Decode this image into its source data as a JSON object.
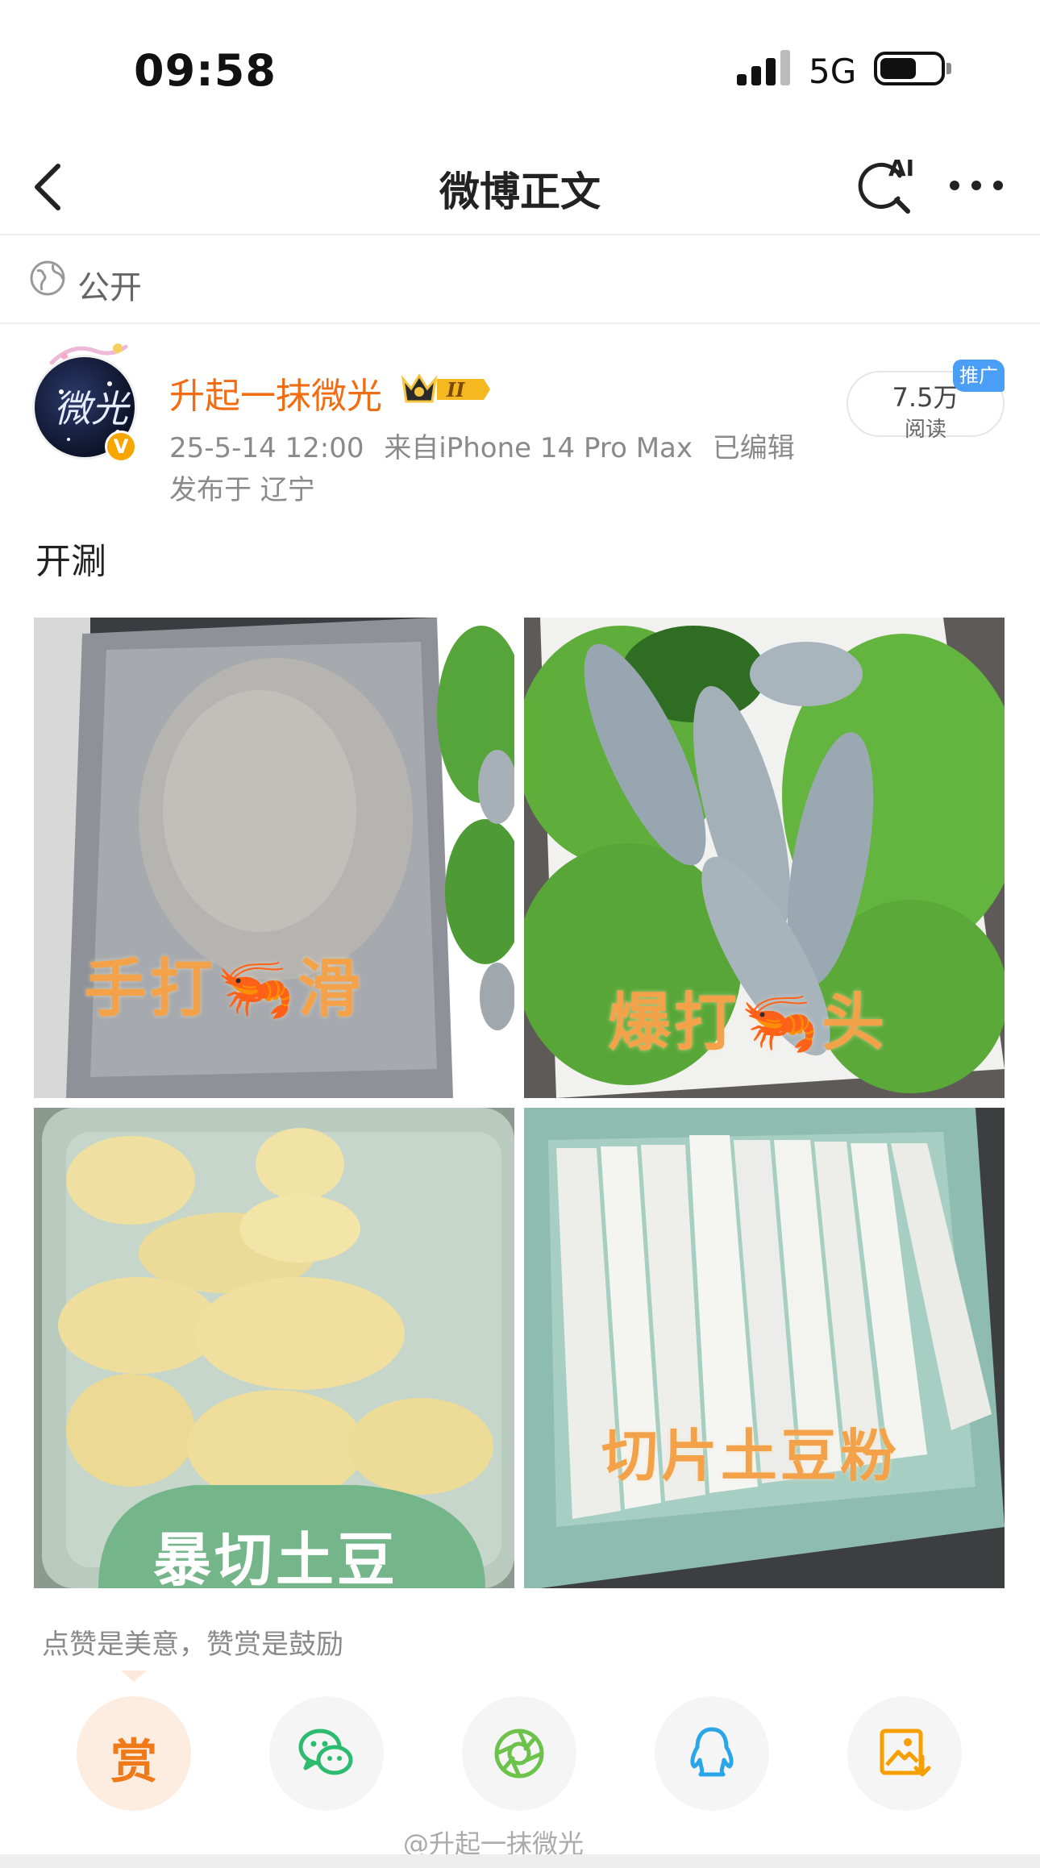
{
  "status_bar": {
    "time": "09:58",
    "network": "5G"
  },
  "nav": {
    "title": "微博正文",
    "ai_label": "AI"
  },
  "visibility": {
    "label": "公开"
  },
  "author": {
    "name": "升起一抹微光",
    "member_level": "II",
    "verified_mark": "V",
    "posted_time": "25-5-14 12:00",
    "source": "来自iPhone 14 Pro Max",
    "edited": "已编辑",
    "location": "发布于 辽宁",
    "avatar_text": "微光"
  },
  "stats": {
    "reads": "7.5万",
    "reads_label": "阅读",
    "promo_label": "推广"
  },
  "post": {
    "text": "开涮",
    "photos": [
      {
        "caption": "手打🦐滑",
        "subject": "shrimp paste on silver tray"
      },
      {
        "caption": "爆打🦐头",
        "subject": "whole shrimp on lettuce"
      },
      {
        "caption": "暴切土豆",
        "subject": "potato slices on green tray"
      },
      {
        "caption": "切片土豆粉",
        "subject": "potato noodle sheets on green tray"
      }
    ]
  },
  "actions": {
    "tip_text": "点赞是美意，赞赏是鼓励",
    "reward_label": "赏"
  },
  "watermark": "@升起一抹微光",
  "colors": {
    "author_name": "#f26c12",
    "reward": "#f07a1a",
    "wechat": "#2dbb6f",
    "moments": "#6cc24a",
    "qq": "#2aa6e8",
    "save": "#f5a000",
    "promo": "#4a9ef5"
  }
}
